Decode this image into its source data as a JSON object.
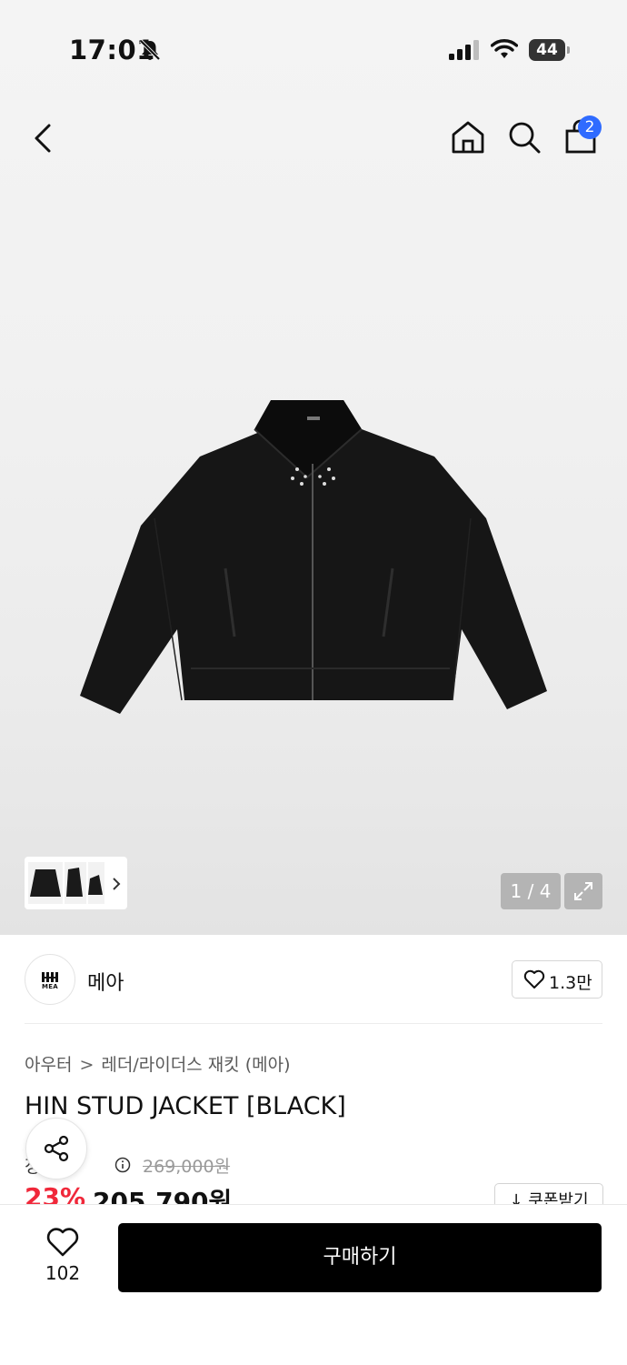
{
  "status_bar": {
    "time": "17:01",
    "battery": "44"
  },
  "header": {
    "cart_count": "2"
  },
  "gallery": {
    "page_indicator": "1 / 4"
  },
  "brand": {
    "name": "메아",
    "logo_text": "MEA",
    "likes": "1.3만"
  },
  "product": {
    "breadcrumb": [
      "아우터",
      "레더/라이더스 재킷 (메아)"
    ],
    "title": "HIN STUD JACKET [BLACK]",
    "price_label": "정상가",
    "original_price": "269,000원",
    "discount_rate": "23%",
    "sale_price": "205,790원",
    "coupon_label": "↓ 쿠폰받기"
  },
  "bottom_bar": {
    "wish_count": "102",
    "buy_label": "구매하기"
  },
  "colors": {
    "accent_blue": "#2f6bff",
    "discount_red": "#f0283a",
    "buy_button": "#000000"
  },
  "icons": [
    "bell-slash-icon",
    "signal-icon",
    "wifi-icon",
    "battery-icon",
    "back-icon",
    "home-icon",
    "search-icon",
    "bag-icon",
    "chevron-right-icon",
    "expand-icon",
    "heart-icon",
    "share-icon",
    "info-icon"
  ]
}
